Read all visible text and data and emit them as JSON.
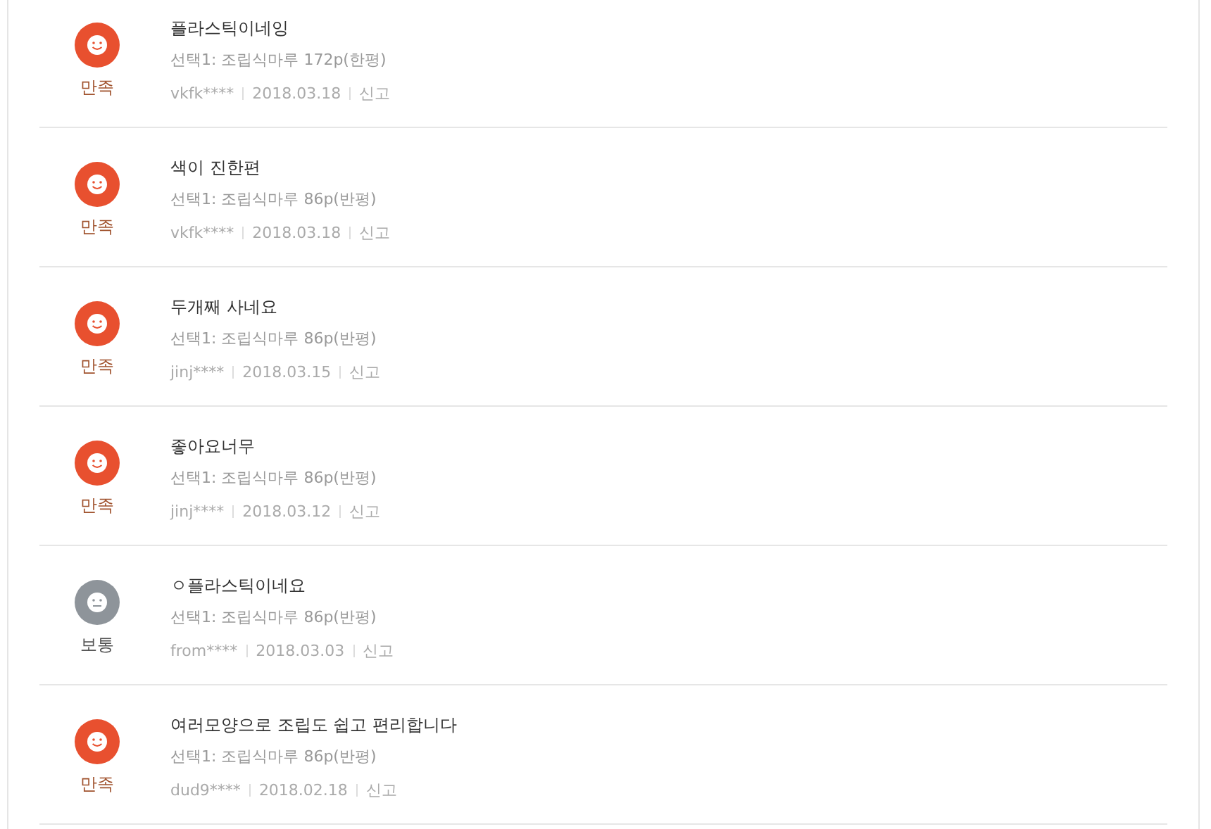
{
  "reviews": [
    {
      "kind": "satisfied",
      "rating": "만족",
      "title": "플라스틱이네잉",
      "option": "선택1: 조립식마루 172p(한평)",
      "user": "vkfk****",
      "date": "2018.03.18",
      "report": "신고"
    },
    {
      "kind": "satisfied",
      "rating": "만족",
      "title": "색이 진한편",
      "option": "선택1: 조립식마루 86p(반평)",
      "user": "vkfk****",
      "date": "2018.03.18",
      "report": "신고"
    },
    {
      "kind": "satisfied",
      "rating": "만족",
      "title": "두개째 사네요",
      "option": "선택1: 조립식마루 86p(반평)",
      "user": "jinj****",
      "date": "2018.03.15",
      "report": "신고"
    },
    {
      "kind": "satisfied",
      "rating": "만족",
      "title": "좋아요너무",
      "option": "선택1: 조립식마루 86p(반평)",
      "user": "jinj****",
      "date": "2018.03.12",
      "report": "신고"
    },
    {
      "kind": "neutral",
      "rating": "보통",
      "title": "ㅇ플라스틱이네요",
      "option": "선택1: 조립식마루 86p(반평)",
      "user": "from****",
      "date": "2018.03.03",
      "report": "신고"
    },
    {
      "kind": "satisfied",
      "rating": "만족",
      "title": "여러모양으로 조립도 쉽고 편리합니다",
      "option": "선택1: 조립식마루 86p(반평)",
      "user": "dud9****",
      "date": "2018.02.18",
      "report": "신고"
    }
  ]
}
